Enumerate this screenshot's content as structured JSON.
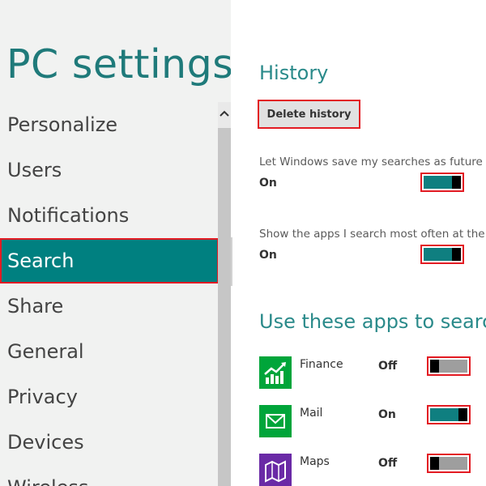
{
  "app_title": "PC settings",
  "nav": {
    "items": [
      {
        "label": "Personalize"
      },
      {
        "label": "Users"
      },
      {
        "label": "Notifications"
      },
      {
        "label": "Search",
        "selected": true
      },
      {
        "label": "Share"
      },
      {
        "label": "General"
      },
      {
        "label": "Privacy"
      },
      {
        "label": "Devices"
      },
      {
        "label": "Wireless"
      }
    ],
    "selected_color": "#008080"
  },
  "history": {
    "heading": "History",
    "delete_button": "Delete history",
    "save_searches": {
      "description": "Let Windows save my searches as future search suggestions",
      "state": "On",
      "toggle_on": true
    },
    "show_apps": {
      "description": "Show the apps I search most often at the top",
      "state": "On",
      "toggle_on": true
    }
  },
  "apps_section": {
    "heading": "Use these apps to search",
    "apps": [
      {
        "name": "Finance",
        "state": "Off",
        "toggle_on": false,
        "icon": "finance-chart-icon",
        "icon_color": "#00a53a"
      },
      {
        "name": "Mail",
        "state": "On",
        "toggle_on": true,
        "icon": "mail-envelope-icon",
        "icon_color": "#00a53a"
      },
      {
        "name": "Maps",
        "state": "Off",
        "toggle_on": false,
        "icon": "maps-icon",
        "icon_color": "#6a2aa6"
      }
    ]
  },
  "colors": {
    "accent": "#008080",
    "toggle_on": "#0f7f80",
    "toggle_off": "#9e9e9e",
    "highlight": "#e31b23"
  }
}
